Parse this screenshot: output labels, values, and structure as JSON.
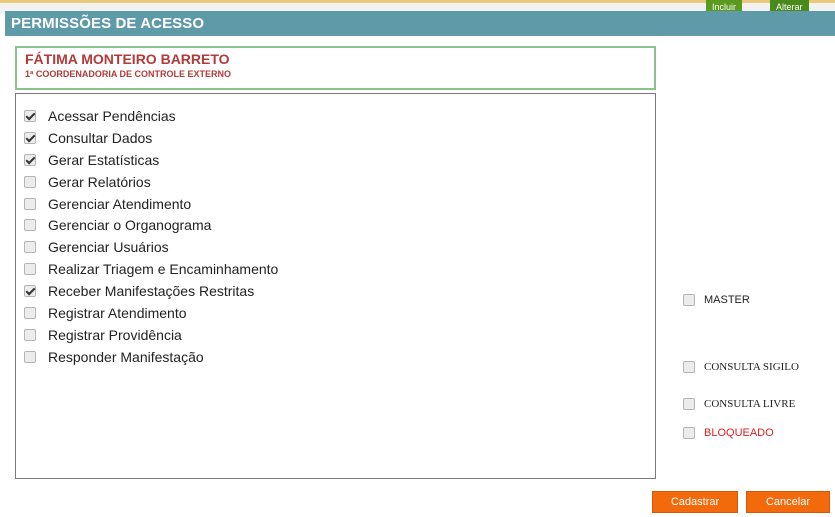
{
  "background_tabs": [
    "Incluir",
    "Alterar"
  ],
  "dialog": {
    "title": "PERMISSÕES DE ACESSO",
    "user": {
      "name": "FÁTIMA MONTEIRO BARRETO",
      "department": "1ª COORDENADORIA DE CONTROLE EXTERNO"
    },
    "permissions": [
      {
        "label": "Acessar Pendências",
        "checked": true
      },
      {
        "label": "Consultar Dados",
        "checked": true
      },
      {
        "label": "Gerar Estatísticas",
        "checked": true
      },
      {
        "label": "Gerar Relatórios",
        "checked": false
      },
      {
        "label": "Gerenciar Atendimento",
        "checked": false
      },
      {
        "label": "Gerenciar o Organograma",
        "checked": false
      },
      {
        "label": "Gerenciar Usuários",
        "checked": false
      },
      {
        "label": "Realizar Triagem e Encaminhamento",
        "checked": false
      },
      {
        "label": "Receber Manifestações Restritas",
        "checked": true
      },
      {
        "label": "Registrar Atendimento",
        "checked": false
      },
      {
        "label": "Registrar Providência",
        "checked": false
      },
      {
        "label": "Responder Manifestação",
        "checked": false
      }
    ],
    "options": {
      "master": {
        "label": "MASTER",
        "checked": false
      },
      "consulta_sigilo": {
        "label": "CONSULTA SIGILO",
        "checked": false
      },
      "consulta_livre": {
        "label": "CONSULTA LIVRE",
        "checked": false
      },
      "bloqueado": {
        "label": "BLOQUEADO",
        "checked": false
      }
    },
    "buttons": {
      "save": "Cadastrar",
      "cancel": "Cancelar"
    },
    "colors": {
      "titlebar": "#5f9aa8",
      "user_text": "#b23a3a",
      "header_border": "#8cc08c",
      "button": "#f26a0c",
      "bloqueado": "#e02020"
    }
  }
}
